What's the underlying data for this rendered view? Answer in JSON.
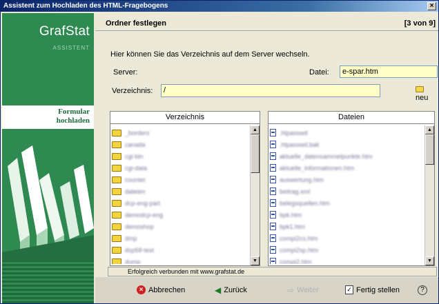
{
  "window": {
    "title": "Assistent zum Hochladen des HTML-Fragebogens",
    "close_label": "×"
  },
  "sidebar": {
    "brand": "GrafStat",
    "brand_sub": "ASSISTENT",
    "step_line1": "Formular",
    "step_line2": "hochladen"
  },
  "header": {
    "title": "Ordner festlegen",
    "step": "[3 von 9]"
  },
  "description": "Hier können Sie das Verzeichnis auf dem Server wechseln.",
  "server_label": "Server:",
  "datei_label": "Datei:",
  "datei_value": "e-spar.htm",
  "verzeichnis_label": "Verzeichnis:",
  "verzeichnis_value": "/",
  "new_folder_label": "neu",
  "folders": {
    "header": "Verzeichnis",
    "items": [
      "_borders",
      "canada",
      "cgi-bin",
      "cgi-data",
      "counter",
      "dateien",
      "dcp-eng-part",
      "demodcp-eng",
      "demoshop",
      "dmp",
      "dsp58-test",
      "dump"
    ]
  },
  "files": {
    "header": "Dateien",
    "items": [
      ".htpasswd",
      ".htpasswd.bak",
      "aktuelle_datensammelpunkte.htm",
      "aktuelle_informationen.htm",
      "auswertung.htm",
      "beitrag.xml",
      "belegsquellen.htm",
      "bpk.htm",
      "bpk1.htm",
      "compi2cs.htm",
      "compi2sp.htm",
      "compi2.htm"
    ]
  },
  "status": "Erfolgreich verbunden mit www.grafstat.de",
  "buttons": {
    "cancel": "Abbrechen",
    "back": "Zurück",
    "next": "Weiter",
    "finish": "Fertig stellen",
    "help": "?"
  }
}
